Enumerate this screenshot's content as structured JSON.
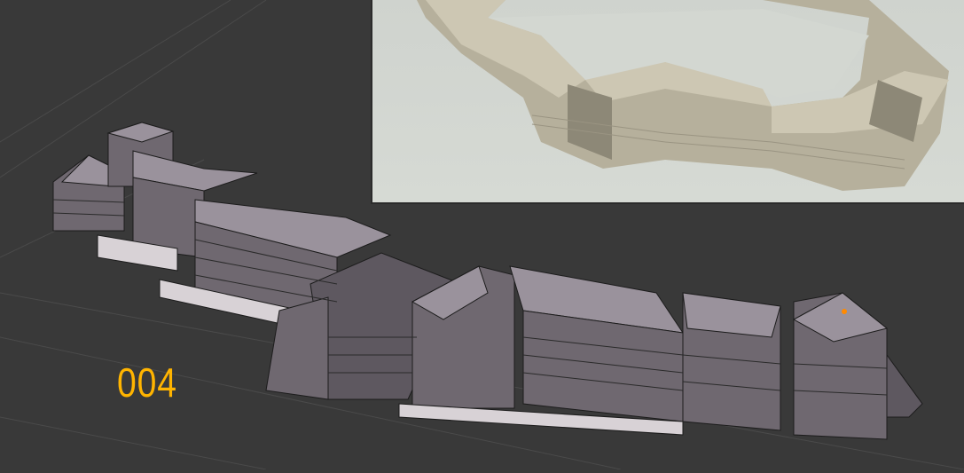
{
  "viewport": {
    "frame_label": "004",
    "frame_label_color": "#ffb400",
    "background_color": "#393939",
    "mesh_color": "#8e8690"
  },
  "render_preview": {
    "background_color": "#d3d7d1",
    "model_color": "#c8c2ae"
  }
}
